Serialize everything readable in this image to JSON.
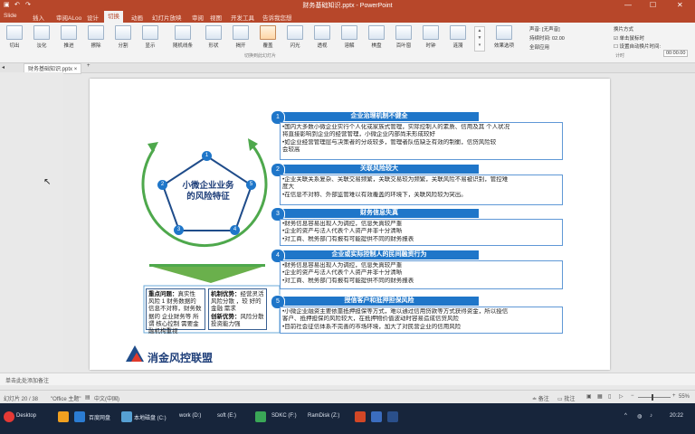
{
  "window": {
    "title": "财务基础知识.pptx  -  PowerPoint",
    "colors": {
      "accent": "#b7472a",
      "slide_blue": "#1f76c9",
      "green": "#4ea84c"
    }
  },
  "tabs": [
    "Slide",
    "插入",
    "审阅ALoo",
    "设计",
    "切换",
    "动画",
    "幻灯片放映",
    "审阅",
    "视图",
    "开发工具",
    "告诉我您想"
  ],
  "ribbon": {
    "items": [
      "切出",
      "淡化",
      "推进",
      "擦除",
      "分割",
      "显示",
      "随机线条",
      "形状",
      "揭开",
      "覆盖",
      "闪光",
      "透视",
      "溶解",
      "棋盘",
      "百叶窗",
      "时钟",
      "涟漪"
    ],
    "group_label": "切换到此幻灯片",
    "effect_options": "效果选项",
    "sound_label": "声音: [无声音]",
    "duration_label": "持续时间: 02.00",
    "apply_all": "全部应用",
    "advance_label": "换片方式",
    "on_click": "单击鼠标时",
    "after_label": "设置自动换片时间:",
    "after_value": "00:00.00",
    "timing_group": "计时"
  },
  "doc_tab": {
    "label": "财务基础知识.pptx",
    "close": "×",
    "add": "+"
  },
  "slide": {
    "center_title": "小微企业业务\n的风险特征",
    "circle_numbers": [
      "1",
      "2",
      "3",
      "4",
      "5"
    ],
    "sections": [
      {
        "num": "1",
        "title": "企业治理机制不健全",
        "lines": [
          "•国内大多数小微企业实行个人化或家族式管理，实际控制人的素质、信用及其 个人状况",
          "将直接影响到企业的经营管理，小微企业内部尚未形成较好",
          "•如企业经营管理层与决策者的分歧较多，管理者队伍缺乏有效的制衡，信贷风险较",
          "会较高"
        ]
      },
      {
        "num": "2",
        "title": "关联风险较大",
        "lines": [
          "•企业关联关系复杂、关联交易频繁，关联交易较为频繁，关联风险不易被识别，管控难",
          "度大",
          "•在信息不对称、外部监管难以有效覆盖的环境下，关联风险较为突出。"
        ]
      },
      {
        "num": "3",
        "title": "财务信息失真",
        "lines": [
          "•财务信息容易出现人为调控，信息失真较严重",
          "•企业的资产与法人代表个人资产并非十分清晰",
          "•对工商、税务部门有报有可能提供不同的财务报表"
        ]
      },
      {
        "num": "4",
        "title": "企业或实际控制人的民间融资行为",
        "lines": [
          "•财务信息容易出现人为调控，信息失真较严重",
          "•企业的资产与法人代表个人资产并非十分清晰",
          "•对工商、税务部门有报有可能提供不同的财务报表"
        ]
      },
      {
        "num": "5",
        "title": "授信客户和抵押担保风险",
        "lines": [
          "•小微企业融资主要依靠抵押担保等方式，难以通过信用贷款等方式获得资金，所以授信",
          "客户、抵押担保的风险较大，在抵押物价值波动时容易造成信贷风险",
          "•目前社会征信体系不完善的市场环境，加大了对民营企业的信用风险"
        ]
      }
    ],
    "bottom_left": {
      "heading": "重点问题：",
      "text": "真实性 风险 1 财务数据的 信息不对称，财务数据的 企业财务等 所谓 核心控制 需要金融机构重视"
    },
    "bottom_right": {
      "heading1": "机制优势：",
      "text1": "经营灵活 风险分散 ，较 好的金融 需求",
      "heading2": "创新优势：",
      "text2": "风险分散 投资能力强"
    },
    "logo_text": "消金风控联盟"
  },
  "notes_text": "单击此处添加备注",
  "status": {
    "slide_info": "幻灯片 20 / 38",
    "theme": "\"Office 主题\"",
    "language": "中文(中国)",
    "notes_btn": "备注",
    "comments_btn": "批注",
    "zoom": "55%"
  },
  "taskbar": {
    "desktop": "Desktop",
    "items": [
      "百度网盘",
      "本地磁盘 (C:)",
      "work (D:)",
      "soft (E:)",
      "SDKC (F:)",
      "RamDisk (Z:)"
    ],
    "time": "20:22"
  }
}
